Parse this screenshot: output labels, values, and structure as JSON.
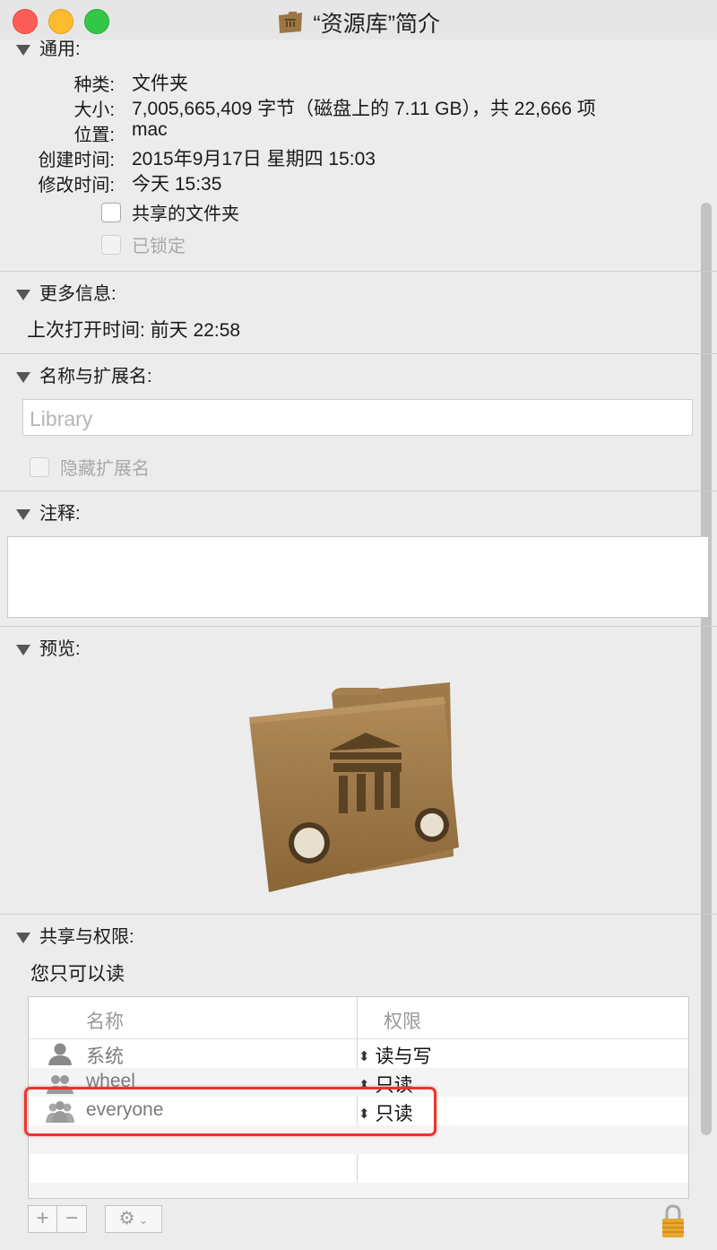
{
  "window": {
    "title": "“资源库”简介"
  },
  "general": {
    "header": "通用:",
    "rows": [
      {
        "label": "种类:",
        "value": "文件夹"
      },
      {
        "label": "大小:",
        "value": "7,005,665,409 字节（磁盘上的 7.11 GB），共 22,666 项"
      },
      {
        "label": "位置:",
        "value": "mac"
      },
      {
        "label": "创建时间:",
        "value": "2015年9月17日 星期四 15:03"
      },
      {
        "label": "修改时间:",
        "value": "今天 15:35"
      }
    ],
    "shared_folder_label": "共享的文件夹",
    "locked_label": "已锁定"
  },
  "more_info": {
    "header": "更多信息:",
    "last_opened": "上次打开时间: 前天 22:58"
  },
  "name_ext": {
    "header": "名称与扩展名:",
    "name_value": "Library",
    "hide_ext_label": "隐藏扩展名"
  },
  "comments": {
    "header": "注释:"
  },
  "preview": {
    "header": "预览:"
  },
  "sharing": {
    "header": "共享与权限:",
    "access_note": "您只可以读",
    "columns": {
      "name": "名称",
      "privilege": "权限"
    },
    "rows": [
      {
        "name": "系统",
        "privilege": "读与写",
        "icon": "user-icon"
      },
      {
        "name": "wheel",
        "privilege": "只读",
        "icon": "group-icon"
      },
      {
        "name": "everyone",
        "privilege": "只读",
        "icon": "everyone-icon"
      }
    ],
    "add_symbol": "+",
    "remove_symbol": "−",
    "action_menu_icon": "gear-icon",
    "lock_icon": "lock-icon"
  },
  "colors": {
    "highlight": "#e8362c",
    "close": "#fc5e57",
    "minimize": "#fdbc2e",
    "zoom": "#33c748",
    "folder": "#9c7746"
  }
}
